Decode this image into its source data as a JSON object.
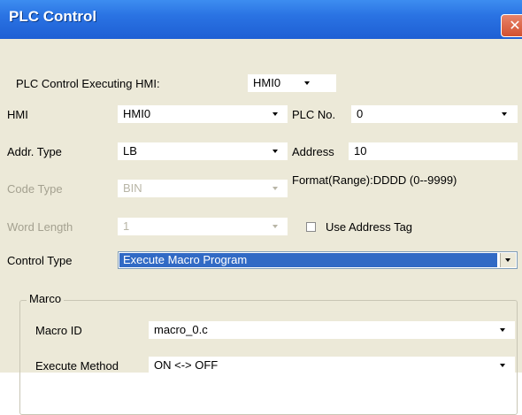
{
  "window": {
    "title": "PLC Control",
    "close_glyph": "✕"
  },
  "executing_hmi": {
    "label": "PLC Control Executing HMI:",
    "value": "HMI0"
  },
  "hmi": {
    "label": "HMI",
    "value": "HMI0"
  },
  "plc_no": {
    "label": "PLC No.",
    "value": "0"
  },
  "addr_type": {
    "label": "Addr. Type",
    "value": "LB"
  },
  "address": {
    "label": "Address",
    "value": "10"
  },
  "code_type": {
    "label": "Code Type",
    "value": "BIN"
  },
  "format_hint": "Format(Range):DDDD (0--9999)",
  "word_length": {
    "label": "Word Length",
    "value": "1"
  },
  "use_address_tag": {
    "label": "Use Address Tag",
    "checked": false
  },
  "control_type": {
    "label": "Control Type",
    "value": "Execute Macro Program"
  },
  "macro_group": {
    "legend": "Marco",
    "macro_id": {
      "label": "Macro ID",
      "value": "macro_0.c"
    },
    "execute_method": {
      "label": "Execute Method",
      "value": "ON <-> OFF"
    }
  },
  "colors": {
    "titlebar": "#2a73e3",
    "dialog_bg": "#ece9d8",
    "selection": "#316ac5",
    "close": "#d2512f"
  }
}
